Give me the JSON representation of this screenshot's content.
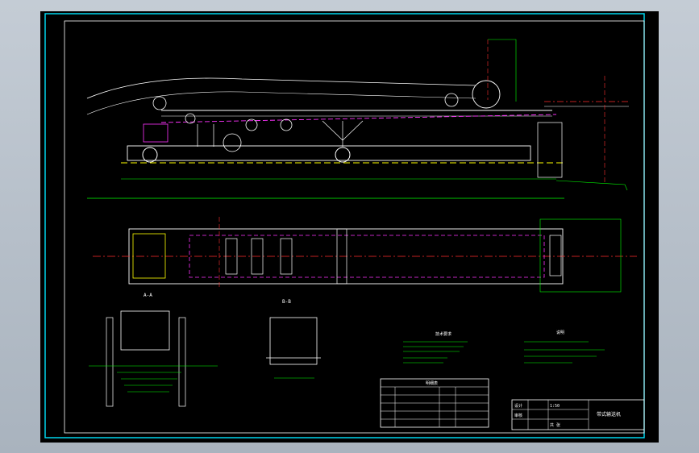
{
  "viewer": {
    "background_color": "#b3bcc6",
    "sheet_color": "#000000",
    "border_color": "#00e5ff"
  },
  "drawing": {
    "colors": {
      "outline": "#ffffff",
      "dimension": "#00ff00",
      "centerline": "#ff2d2d",
      "hidden": "#ffff00",
      "magenta": "#ff33ff",
      "border": "#00e5ff"
    },
    "section_labels": {
      "view_a": "A-A",
      "view_b": "B-B"
    },
    "title_block": {
      "sheet_label": "共 张",
      "scale": "1:50",
      "drawn": "设计",
      "check": "审核",
      "title": "带式输送机"
    },
    "parts_table_title": "明细表",
    "notes_left_title": "技术要求",
    "notes_right_title": "说明"
  }
}
